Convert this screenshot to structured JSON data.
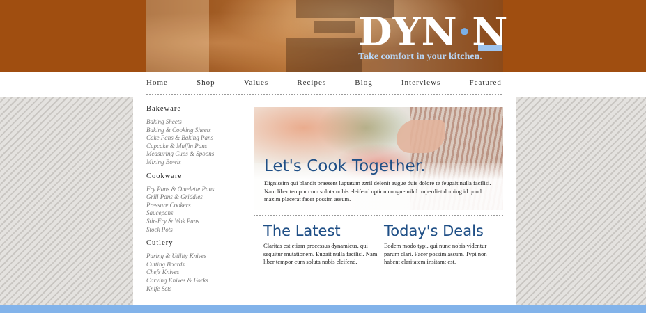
{
  "header": {
    "logo_main": "DYN",
    "logo_dot": "·",
    "logo_end": "N",
    "tagline": "Take comfort in your kitchen."
  },
  "nav": {
    "items": [
      "Home",
      "Shop",
      "Values",
      "Recipes",
      "Blog",
      "Interviews",
      "Featured"
    ]
  },
  "sidebar": {
    "categories": [
      {
        "title": "Bakeware",
        "items": [
          "Baking Sheets",
          "Baking & Cooking Sheets",
          "Cake Pans & Baking Pans",
          "Cupcake & Muffin Pans",
          "Measuring Cups & Spoons",
          "Mixing Bowls"
        ]
      },
      {
        "title": "Cookware",
        "items": [
          "Fry Pans & Omelette Pans",
          "Grill Pans & Griddles",
          "Pressure Cookers",
          "Saucepans",
          "Stir-Fry & Wok Pans",
          "Stock Pots"
        ]
      },
      {
        "title": "Cutlery",
        "items": [
          "Paring & Utility Knives",
          "Cutting Boards",
          "Chefs Knives",
          "Carving Knives & Forks",
          "Knife Sets"
        ]
      }
    ]
  },
  "hero": {
    "title": "Let's Cook Together.",
    "text": "Dignissim qui blandit praesent luptatum zzril delenit augue duis dolore te feugait nulla facilisi. Nam liber tempor cum soluta nobis eleifend option congue nihil imperdiet doming id quod mazim placerat facer possim assum."
  },
  "latest": {
    "title": "The Latest",
    "text": "Claritas est etiam processus dynamicus, qui sequitur mutationem. Eugait nulla facilisi. Nam liber tempor cum soluta nobis eleifend."
  },
  "deals": {
    "title": "Today's Deals",
    "text": "Eodem modo typi, qui nunc nobis videntur parum clari. Facer possim assum. Typi non habent claritatem insitam; est."
  },
  "colors": {
    "header_bg": "#a04e10",
    "accent_blue": "#1f4f86",
    "footer_bar": "#82b3ea"
  }
}
